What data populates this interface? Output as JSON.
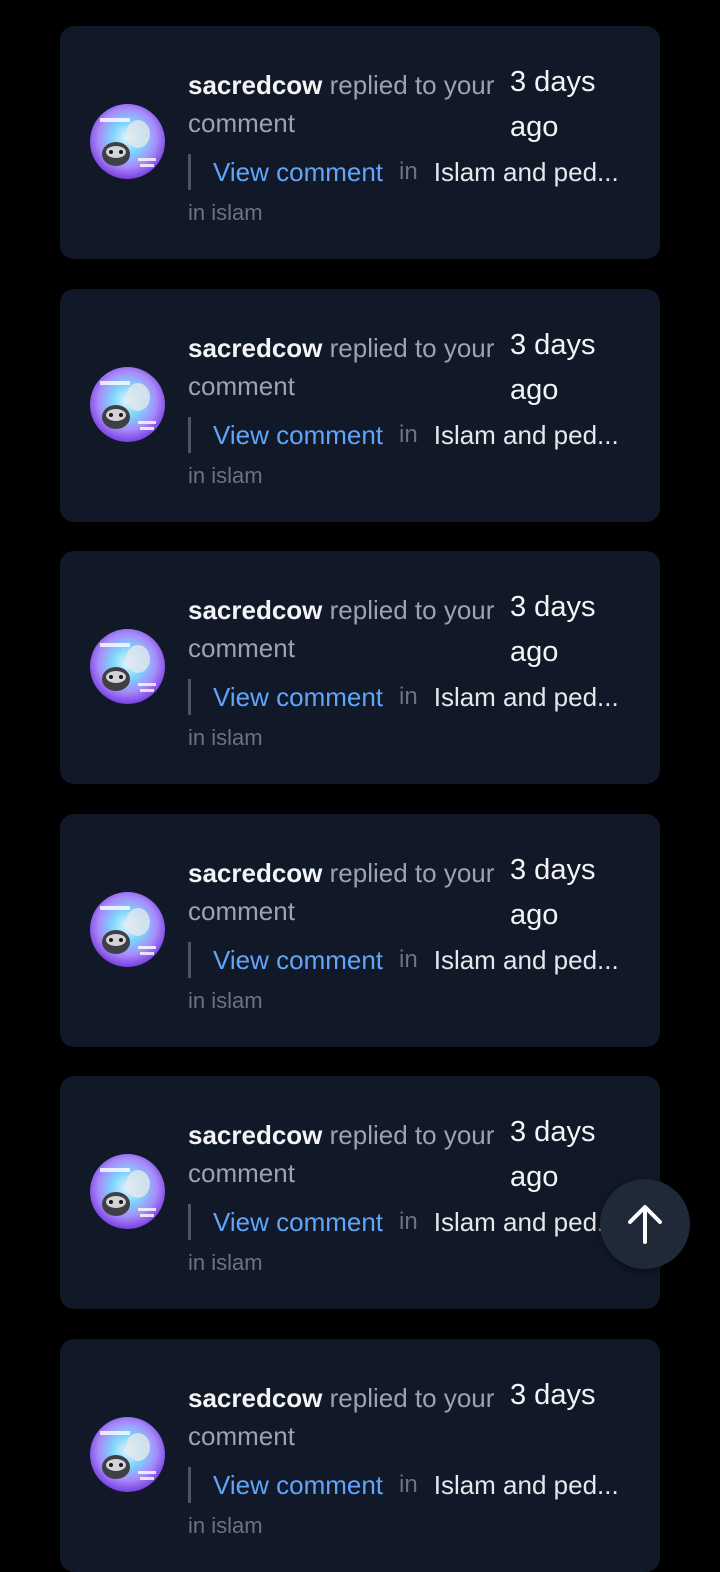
{
  "notifications": [
    {
      "username": "sacredcow",
      "action": "replied to your comment",
      "time": "3 days ago",
      "link_label": "View comment",
      "in_label": "in",
      "post_title": "Islam and ped...",
      "community": "in islam"
    },
    {
      "username": "sacredcow",
      "action": "replied to your comment",
      "time": "3 days ago",
      "link_label": "View comment",
      "in_label": "in",
      "post_title": "Islam and ped...",
      "community": "in islam"
    },
    {
      "username": "sacredcow",
      "action": "replied to your comment",
      "time": "3 days ago",
      "link_label": "View comment",
      "in_label": "in",
      "post_title": "Islam and ped...",
      "community": "in islam"
    },
    {
      "username": "sacredcow",
      "action": "replied to your comment",
      "time": "3 days ago",
      "link_label": "View comment",
      "in_label": "in",
      "post_title": "Islam and ped...",
      "community": "in islam"
    },
    {
      "username": "sacredcow",
      "action": "replied to your comment",
      "time": "3 days ago",
      "link_label": "View comment",
      "in_label": "in",
      "post_title": "Islam and ped...",
      "community": "in islam"
    },
    {
      "username": "sacredcow",
      "action": "replied to your comment",
      "time": "3 days",
      "link_label": "View comment",
      "in_label": "in",
      "post_title": "Islam and ped...",
      "community": "in islam"
    }
  ],
  "scroll_top_button": {
    "icon": "arrow-up-icon"
  },
  "colors": {
    "background": "#000000",
    "card": "#111827",
    "link": "#60a5fa",
    "text_primary": "#f3f4f6",
    "text_muted": "#9ca3af"
  }
}
